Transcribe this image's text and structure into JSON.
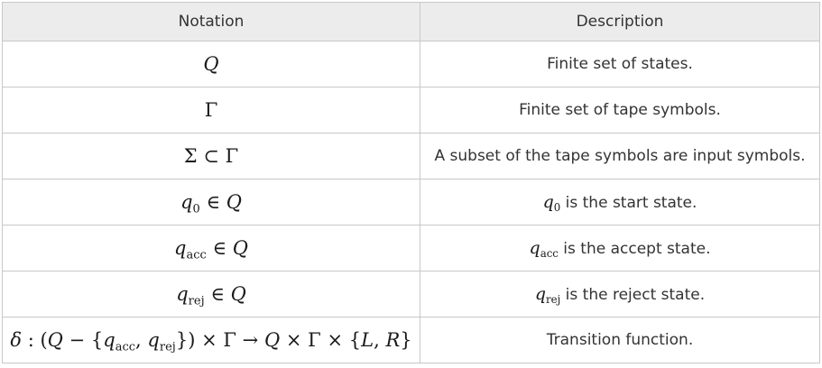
{
  "table": {
    "headers": {
      "notation": "Notation",
      "description": "Description"
    },
    "rows": [
      {
        "description": "Finite set of states."
      },
      {
        "description": "Finite set of tape symbols."
      },
      {
        "description": "A subset of the tape symbols are input symbols."
      },
      {
        "description": " is the start state."
      },
      {
        "description": " is the accept state."
      },
      {
        "description": " is the reject state."
      },
      {
        "description": "Transition function."
      }
    ]
  },
  "symbols": {
    "Q": "Q",
    "Gamma": "Γ",
    "Sigma": "Σ",
    "subset": "⊂",
    "elem": "∈",
    "q": "q",
    "sub0": "0",
    "acc": "acc",
    "rej": "rej",
    "delta": "δ",
    "colon": ":",
    "minus": "−",
    "times": "×",
    "arrow": "→",
    "lbrace": "{",
    "rbrace": "}",
    "lparen": "(",
    "rparen": ")",
    "comma": ",",
    "L": "L",
    "R": "R"
  }
}
